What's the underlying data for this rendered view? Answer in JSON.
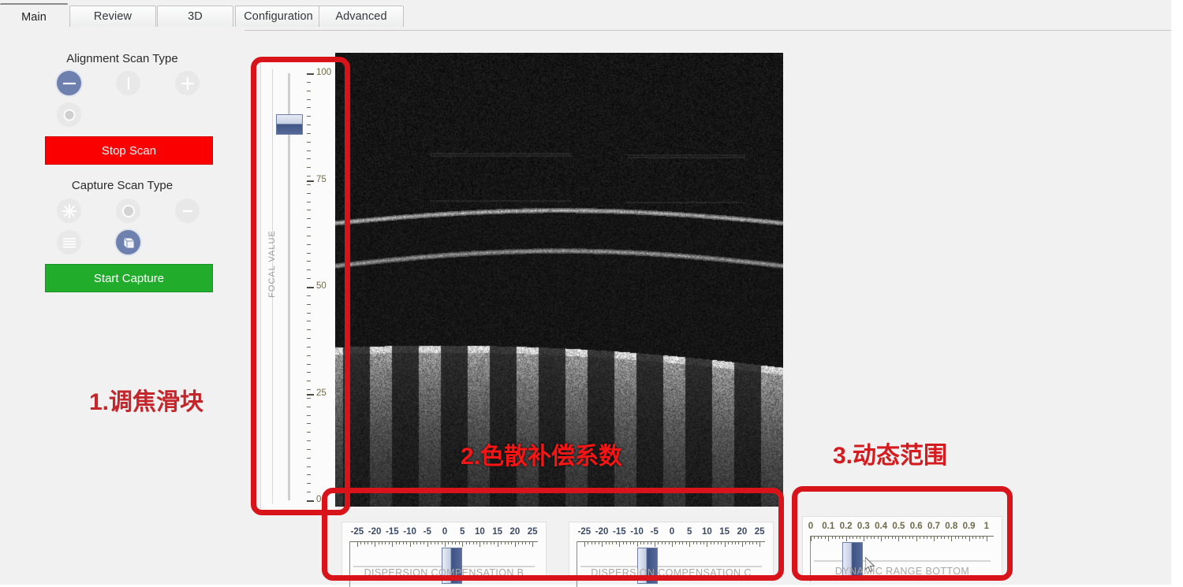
{
  "window": {
    "app_background": "#f1f1f1",
    "accent_red": "#d8141a",
    "accent_blue": "#6e80ad"
  },
  "tabs": [
    {
      "label": "Main",
      "active": true
    },
    {
      "label": "Review",
      "active": false
    },
    {
      "label": "3D",
      "active": false
    },
    {
      "label": "Configuration",
      "active": false
    },
    {
      "label": "Advanced",
      "active": false
    }
  ],
  "left_panel": {
    "alignment_scan_type": {
      "label": "Alignment Scan Type",
      "icons": [
        {
          "name": "horizontal-line-scan-icon",
          "selected": true
        },
        {
          "name": "vertical-line-scan-icon",
          "selected": false
        },
        {
          "name": "cross-scan-icon",
          "selected": false
        },
        {
          "name": "circle-scan-icon",
          "selected": false
        }
      ]
    },
    "stop_scan_label": "Stop Scan",
    "stop_scan_color": "#fb0000",
    "capture_scan_type": {
      "label": "Capture Scan Type",
      "icons": [
        {
          "name": "radial-star-scan-icon",
          "selected": false
        },
        {
          "name": "circle-scan-icon",
          "selected": false
        },
        {
          "name": "single-line-scan-icon",
          "selected": false
        },
        {
          "name": "raster-lines-scan-icon",
          "selected": false
        },
        {
          "name": "volume-cube-scan-icon",
          "selected": true
        }
      ]
    },
    "start_capture_label": "Start Capture",
    "start_capture_color": "#21ad2b"
  },
  "focal_slider": {
    "label": "FOCAL VALUE",
    "min": 0,
    "max": 100,
    "value": 88,
    "major_ticks": [
      0,
      25,
      50,
      75,
      100
    ],
    "tick_labels": [
      "0",
      "25",
      "50",
      "75",
      "100"
    ]
  },
  "bottom_sliders": [
    {
      "id": "dispersion-compensation-b",
      "label": "DISPERSION COMPENSATION B",
      "min": -27,
      "max": 27,
      "value": 2,
      "tick_labels": [
        "-25",
        "-20",
        "-15",
        "-10",
        "-5",
        "0",
        "5",
        "10",
        "15",
        "20",
        "25"
      ],
      "tick_values": [
        -25,
        -20,
        -15,
        -10,
        -5,
        0,
        5,
        10,
        15,
        20,
        25
      ]
    },
    {
      "id": "dispersion-compensation-c",
      "label": "DISPERSION COMPENSATION C",
      "min": -27,
      "max": 27,
      "value": -7,
      "tick_labels": [
        "-25",
        "-20",
        "-15",
        "-10",
        "-5",
        "0",
        "5",
        "10",
        "15",
        "20",
        "25"
      ],
      "tick_values": [
        -25,
        -20,
        -15,
        -10,
        -5,
        0,
        5,
        10,
        15,
        20,
        25
      ]
    },
    {
      "id": "dynamic-range-bottom",
      "label": "DYNAMIC RANGE BOTTOM",
      "min": 0,
      "max": 1.05,
      "value": 0.24,
      "tick_labels": [
        "0",
        "0.1",
        "0.2",
        "0.3",
        "0.4",
        "0.5",
        "0.6",
        "0.7",
        "0.8",
        "0.9",
        "1"
      ],
      "tick_values": [
        0,
        0.1,
        0.2,
        0.3,
        0.4,
        0.5,
        0.6,
        0.7,
        0.8,
        0.9,
        1.0
      ]
    }
  ],
  "annotations": [
    {
      "id": "annot-focus-slider",
      "text": "1.调焦滑块",
      "color": "#c4262b"
    },
    {
      "id": "annot-dispersion",
      "text": "2.色散补偿系数",
      "color": "#f41515"
    },
    {
      "id": "annot-dynamic-range",
      "text": "3.动态范围",
      "color": "#d41b1f"
    }
  ],
  "oct_image": {
    "name": "oct-b-scan-image",
    "description": "OCT B-scan grayscale tomogram"
  }
}
